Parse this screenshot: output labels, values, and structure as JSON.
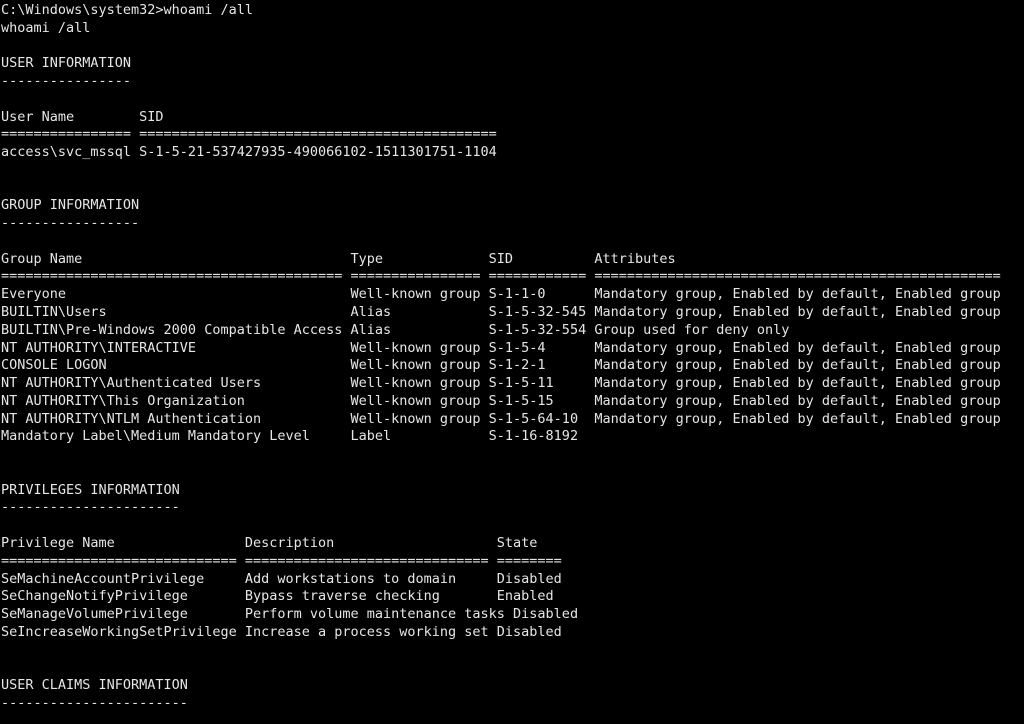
{
  "terminal": {
    "lines": [
      "C:\\Windows\\system32>whoami /all",
      "whoami /all",
      "",
      "USER INFORMATION",
      "----------------",
      "",
      "User Name        SID",
      "================ ============================================",
      "access\\svc_mssql S-1-5-21-537427935-490066102-1511301751-1104",
      "",
      "",
      "GROUP INFORMATION",
      "-----------------",
      "",
      "Group Name                                 Type             SID          Attributes",
      "========================================== ================ ============ ==================================================",
      "Everyone                                   Well-known group S-1-1-0      Mandatory group, Enabled by default, Enabled group",
      "BUILTIN\\Users                              Alias            S-1-5-32-545 Mandatory group, Enabled by default, Enabled group",
      "BUILTIN\\Pre-Windows 2000 Compatible Access Alias            S-1-5-32-554 Group used for deny only",
      "NT AUTHORITY\\INTERACTIVE                   Well-known group S-1-5-4      Mandatory group, Enabled by default, Enabled group",
      "CONSOLE LOGON                              Well-known group S-1-2-1      Mandatory group, Enabled by default, Enabled group",
      "NT AUTHORITY\\Authenticated Users           Well-known group S-1-5-11     Mandatory group, Enabled by default, Enabled group",
      "NT AUTHORITY\\This Organization             Well-known group S-1-5-15     Mandatory group, Enabled by default, Enabled group",
      "NT AUTHORITY\\NTLM Authentication           Well-known group S-1-5-64-10  Mandatory group, Enabled by default, Enabled group",
      "Mandatory Label\\Medium Mandatory Level     Label            S-1-16-8192",
      "",
      "",
      "PRIVILEGES INFORMATION",
      "----------------------",
      "",
      "Privilege Name                Description                    State",
      "============================= ============================== ========",
      "SeMachineAccountPrivilege     Add workstations to domain     Disabled",
      "SeChangeNotifyPrivilege       Bypass traverse checking       Enabled",
      "SeManageVolumePrivilege       Perform volume maintenance tasks Disabled",
      "SeIncreaseWorkingSetPrivilege Increase a process working set Disabled",
      "",
      "",
      "USER CLAIMS INFORMATION",
      "-----------------------"
    ]
  },
  "colors": {
    "background": "#000000",
    "foreground": "#e6e6e6"
  }
}
